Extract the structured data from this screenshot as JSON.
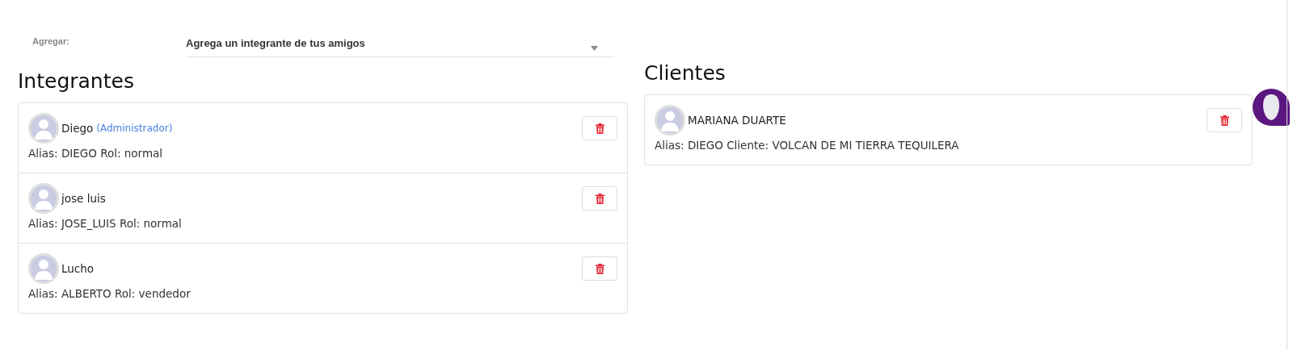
{
  "add_member": {
    "label": "Agregar:",
    "value": "Agrega un integrante de tus amigos"
  },
  "members": {
    "title": "Integrantes",
    "items": [
      {
        "name": "Diego",
        "tag": "(Administrador)",
        "detail": "Alias: DIEGO Rol: normal"
      },
      {
        "name": "jose luis",
        "detail": "Alias: JOSE_LUIS Rol: normal"
      },
      {
        "name": "Lucho",
        "detail": "Alias: ALBERTO Rol: vendedor"
      }
    ]
  },
  "clients": {
    "title": "Clientes",
    "items": [
      {
        "name": "MARIANA DUARTE",
        "detail": "Alias: DIEGO Cliente: VOLCAN DE MI TIERRA TEQUILERA"
      }
    ]
  }
}
